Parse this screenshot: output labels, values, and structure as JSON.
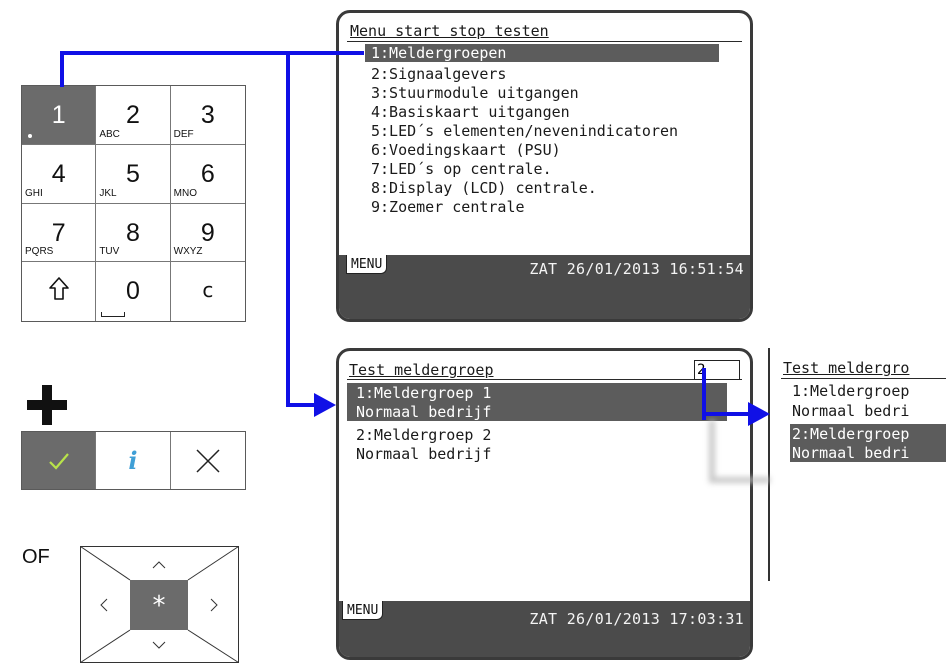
{
  "keypad": {
    "keys": [
      {
        "num": "1",
        "sub": ""
      },
      {
        "num": "2",
        "sub": "ABC"
      },
      {
        "num": "3",
        "sub": "DEF"
      },
      {
        "num": "4",
        "sub": "GHI"
      },
      {
        "num": "5",
        "sub": "JKL"
      },
      {
        "num": "6",
        "sub": "MNO"
      },
      {
        "num": "7",
        "sub": "PQRS"
      },
      {
        "num": "8",
        "sub": "TUV"
      },
      {
        "num": "9",
        "sub": "WXYZ"
      },
      {
        "num": "0",
        "sub": ""
      },
      {
        "num": "c",
        "sub": ""
      }
    ],
    "shift_icon": "up-arrow-outline-icon",
    "active_key": "1"
  },
  "actions": {
    "confirm_icon": "checkmark-icon",
    "info_label": "i",
    "cancel_icon": "close-icon",
    "confirm_color": "#b8e34a",
    "info_color": "#3f9fd6"
  },
  "or_label": "OF",
  "dpad": {
    "center_label": "*"
  },
  "screen1": {
    "title": "Menu start stop testen",
    "items": [
      "1:Meldergroepen",
      "2:Signaalgevers",
      "3:Stuurmodule uitgangen",
      "4:Basiskaart uitgangen",
      "5:LED´s elementen/nevenindicatoren",
      "6:Voedingskaart (PSU)",
      "7:LED´s op centrale.",
      "8:Display (LCD) centrale.",
      "9:Zoemer centrale"
    ],
    "selected_index": 0,
    "menu_label": "MENU",
    "datetime": "ZAT 26/01/2013 16:51:54"
  },
  "screen2": {
    "title": "Test meldergroep",
    "input_value": "2",
    "lines": [
      "1:Meldergroep 1",
      "Normaal bedrijf",
      "2:Meldergroep 2",
      "Normaal bedrijf"
    ],
    "menu_label": "MENU",
    "datetime": "ZAT 26/01/2013 17:03:31"
  },
  "screen3": {
    "title": "Test meldergro",
    "lines": [
      "1:Meldergroep",
      "Normaal bedri",
      "2:Meldergroep",
      "Normaal bedri"
    ]
  },
  "colors": {
    "arrow": "#1010e6",
    "lcd_dark": "#4b4b4b",
    "highlight": "#5c5c5c"
  }
}
